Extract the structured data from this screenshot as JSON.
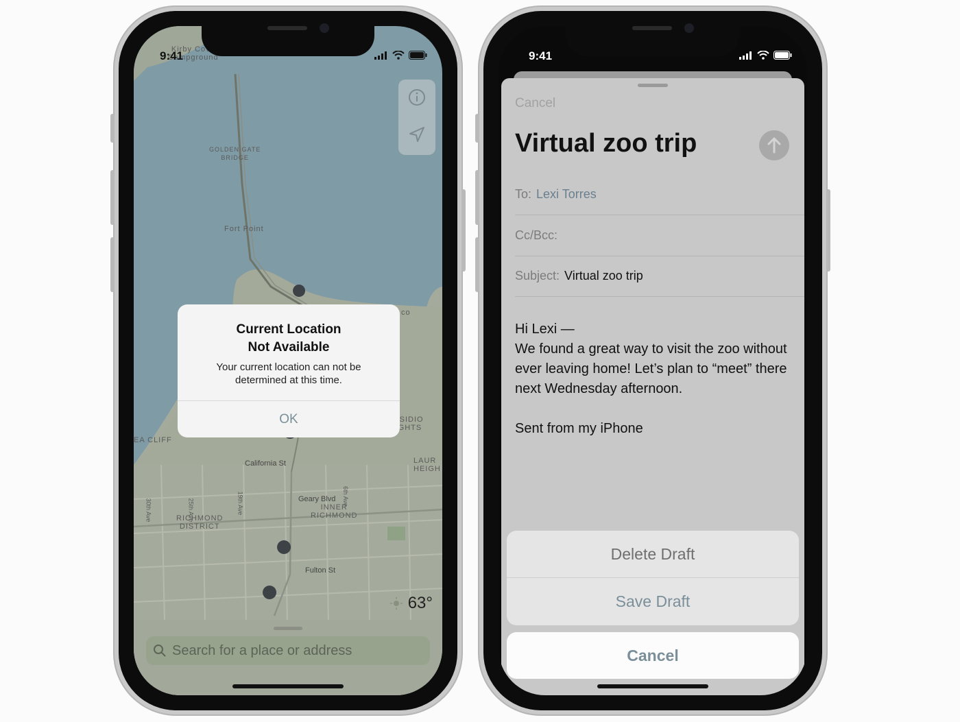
{
  "colors": {
    "water": "#7f9ba6",
    "land": "#a5ab9c",
    "alert_button": "#7a8f9a",
    "mail_link": "#6a7f8e",
    "delete_text": "#6f6f6f",
    "save_text": "#7a8f9a"
  },
  "left_phone": {
    "status": {
      "time": "9:41"
    },
    "map_labels": {
      "kirby": "Kirby Cove\nCampground",
      "golden_gate": "GOLDEN GATE\nBRIDGE",
      "fort_point": "Fort Point",
      "presidio_heights": "PRESIDIO\nHEIGHTS",
      "laurel_heights": "LAUR\nHEIGH",
      "sea_cliff": "EA CLIFF",
      "california_st": "California St",
      "geary_blvd": "Geary Blvd",
      "inner_richmond": "INNER\nRICHMOND",
      "richmond_district": "RICHMOND\nDISTRICT",
      "fulton_st": "Fulton St",
      "ave30": "30th Ave",
      "ave25": "25th Ave",
      "ave19": "19th Ave",
      "ave6": "6th Ave",
      "co": "co"
    },
    "controls": {
      "info_icon": "info-icon",
      "location_icon": "location-arrow-icon"
    },
    "alert": {
      "title": "Current Location\nNot Available",
      "message": "Your current location can not be determined at this time.",
      "ok_label": "OK"
    },
    "weather": {
      "temp": "63°",
      "icon": "sun-icon"
    },
    "search": {
      "placeholder": "Search for a place or address",
      "icon": "search-icon"
    }
  },
  "right_phone": {
    "status": {
      "time": "9:41"
    },
    "compose": {
      "cancel_label": "Cancel",
      "title": "Virtual zoo trip",
      "to_label": "To:",
      "to_value": "Lexi Torres",
      "cc_label": "Cc/Bcc:",
      "subject_label": "Subject:",
      "subject_value": "Virtual zoo trip",
      "body": "Hi Lexi —\nWe found a great way to visit the zoo without ever leaving home! Let’s plan to “meet” there next Wednesday afternoon.\n\nSent from my iPhone"
    },
    "actions": {
      "delete_label": "Delete Draft",
      "save_label": "Save Draft",
      "cancel_label": "Cancel"
    }
  }
}
